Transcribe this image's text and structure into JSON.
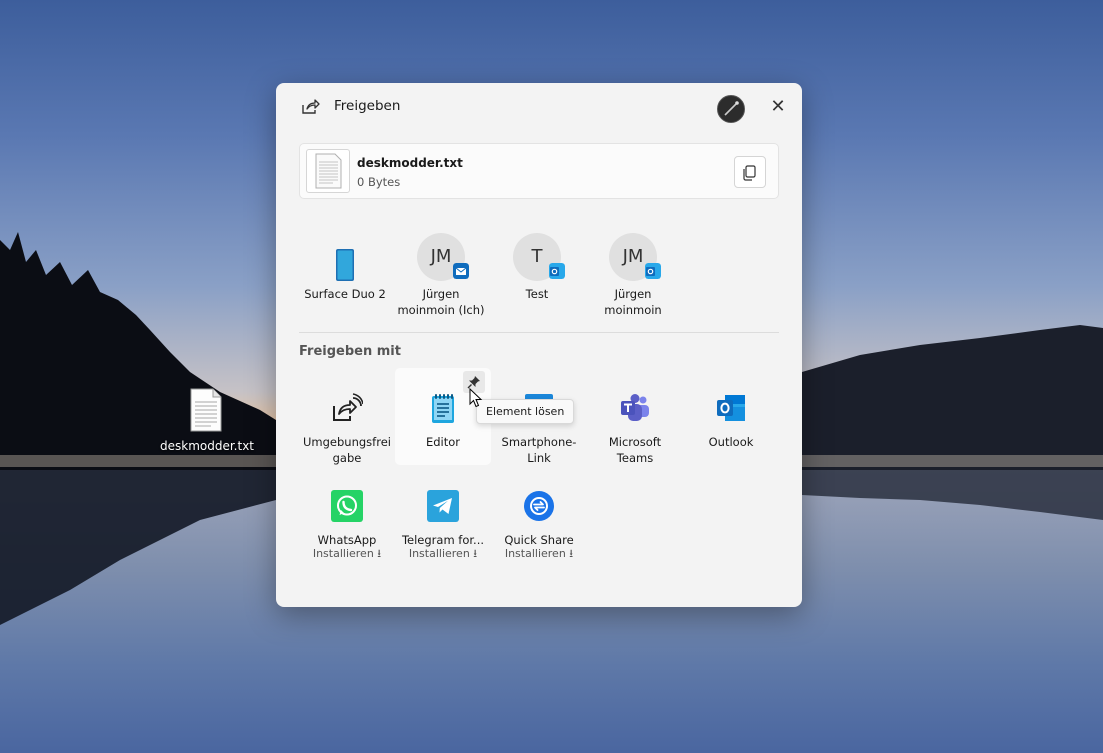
{
  "desktop": {
    "file_icon_label": "deskmodder.txt"
  },
  "share_dialog": {
    "title": "Freigeben",
    "close_label": "✕",
    "file": {
      "name": "deskmodder.txt",
      "size": "0 Bytes"
    },
    "contacts": [
      {
        "initials": "",
        "name": "Surface Duo 2",
        "icon": "phone-icon"
      },
      {
        "initials": "JM",
        "name_line1": "Jürgen",
        "name_line2": "moinmoin (Ich)",
        "badge": "mail-icon"
      },
      {
        "initials": "T",
        "name": "Test",
        "badge": "outlook-icon"
      },
      {
        "initials": "JM",
        "name_line1": "Jürgen",
        "name_line2": "moinmoin",
        "badge": "outlook-icon"
      }
    ],
    "share_with_title": "Freigeben mit",
    "apps": [
      {
        "line1": "Umgebungsfrei",
        "line2": "gabe",
        "icon": "nearby-share-icon"
      },
      {
        "line1": "Editor",
        "icon": "notepad-icon"
      },
      {
        "line1": "Smartphone-",
        "line2": "Link",
        "icon": "phone-link-icon"
      },
      {
        "line1": "Microsoft",
        "line2": "Teams",
        "icon": "teams-icon"
      },
      {
        "line1": "Outlook",
        "icon": "outlook-icon"
      },
      {
        "line1": "WhatsApp",
        "sub": "Installieren ⭳",
        "icon": "whatsapp-icon"
      },
      {
        "line1": "Telegram for...",
        "sub": "Installieren ⭳",
        "icon": "telegram-icon"
      },
      {
        "line1": "Quick Share",
        "sub": "Installieren ⭳",
        "icon": "quick-share-icon"
      }
    ],
    "tooltip": "Element lösen",
    "colors": {
      "outlook_blue": "#0f6cbd",
      "whatsapp_green": "#25d366",
      "telegram_blue": "#2aa3dc",
      "teams_purple": "#5b5fc7",
      "quickshare_blue": "#1a73e8"
    }
  }
}
